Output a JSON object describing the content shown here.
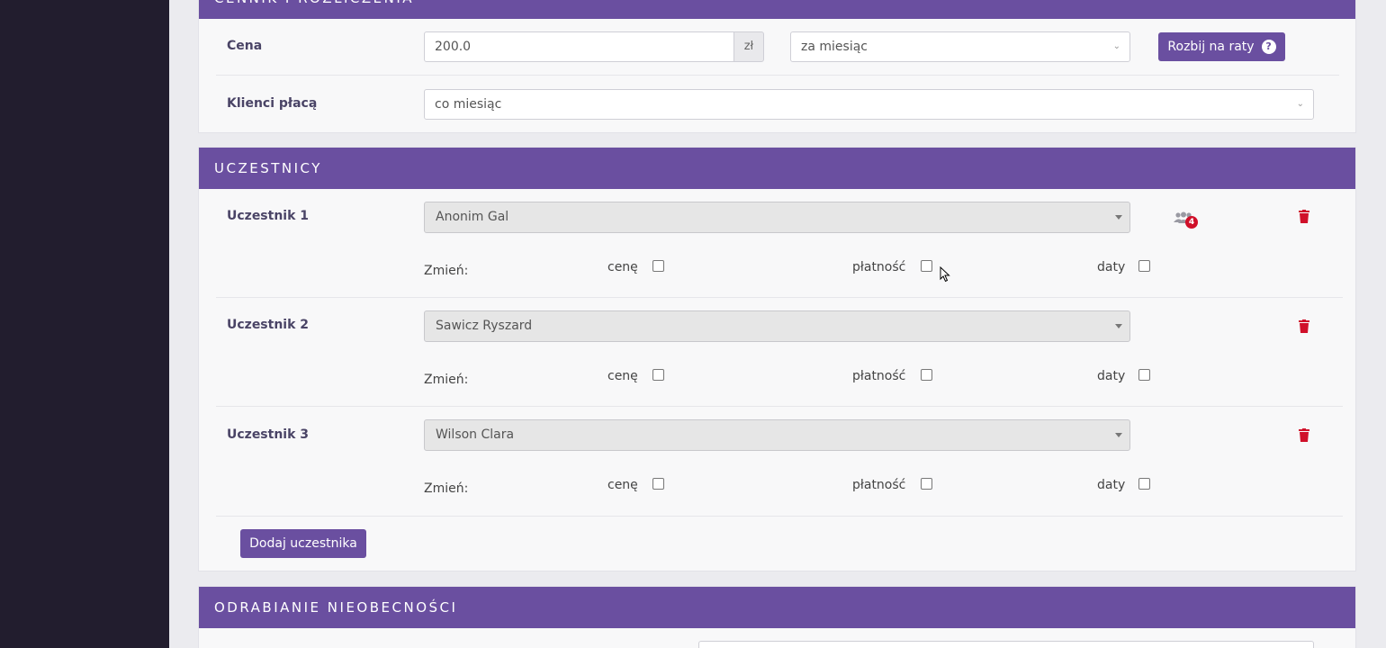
{
  "pricing": {
    "header_title": "CENNIK I ROZLICZENIA",
    "price_label": "Cena",
    "price_value": "200.0",
    "currency": "zł",
    "period_selected": "za miesiąc",
    "split_button": "Rozbij na raty",
    "help_icon": "?",
    "clients_pay_label": "Klienci płacą",
    "clients_pay_selected": "co miesiąc"
  },
  "participants": {
    "header_title": "UCZESTNICY",
    "change_label": "Zmień:",
    "opt_price": "cenę",
    "opt_payment": "płatność",
    "opt_dates": "daty",
    "group_badge": "4",
    "items": [
      {
        "label": "Uczestnik 1",
        "name": "Anonim Gal"
      },
      {
        "label": "Uczestnik 2",
        "name": "Sawicz Ryszard"
      },
      {
        "label": "Uczestnik 3",
        "name": "Wilson Clara"
      }
    ],
    "add_button": "Dodaj uczestnika"
  },
  "absences": {
    "header_title": "ODRABIANIE NIEOBECNOŚCI"
  },
  "colors": {
    "accent": "#6a4fa0",
    "sidebar": "#221d2e",
    "danger": "#d0102a"
  }
}
